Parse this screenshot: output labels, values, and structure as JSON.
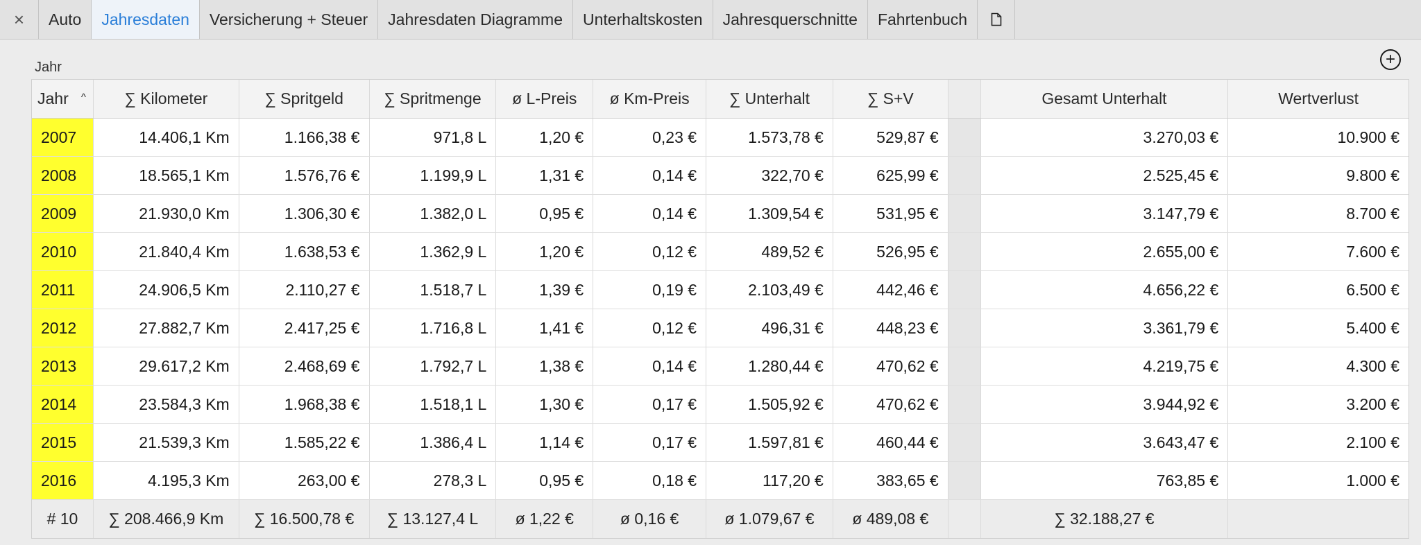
{
  "tabs": {
    "close_icon": "×",
    "items": [
      "Auto",
      "Jahresdaten",
      "Versicherung + Steuer",
      "Jahresdaten Diagramme",
      "Unterhaltskosten",
      "Jahresquerschnitte",
      "Fahrtenbuch"
    ],
    "active": "Jahresdaten",
    "active_color": "#2a7ed8",
    "doc_icon": "document-icon"
  },
  "section": {
    "label": "Jahr",
    "add_icon": "⊕"
  },
  "table": {
    "headers": [
      "Jahr",
      "∑ Kilometer",
      "∑ Spritgeld",
      "∑ Spritmenge",
      "ø L-Preis",
      "ø Km-Preis",
      "∑ Unterhalt",
      "∑ S+V",
      "",
      "Gesamt Unterhalt",
      "Wertverlust"
    ],
    "sort_indicator": "^",
    "year_highlight_color": "#ffff2e",
    "rows": [
      [
        "2007",
        "14.406,1 Km",
        "1.166,38 €",
        "971,8 L",
        "1,20 €",
        "0,23 €",
        "1.573,78 €",
        "529,87 €",
        "",
        "3.270,03 €",
        "10.900 €"
      ],
      [
        "2008",
        "18.565,1 Km",
        "1.576,76 €",
        "1.199,9 L",
        "1,31 €",
        "0,14 €",
        "322,70 €",
        "625,99 €",
        "",
        "2.525,45 €",
        "9.800 €"
      ],
      [
        "2009",
        "21.930,0 Km",
        "1.306,30 €",
        "1.382,0 L",
        "0,95 €",
        "0,14 €",
        "1.309,54 €",
        "531,95 €",
        "",
        "3.147,79 €",
        "8.700 €"
      ],
      [
        "2010",
        "21.840,4 Km",
        "1.638,53 €",
        "1.362,9 L",
        "1,20 €",
        "0,12 €",
        "489,52 €",
        "526,95 €",
        "",
        "2.655,00 €",
        "7.600 €"
      ],
      [
        "2011",
        "24.906,5 Km",
        "2.110,27 €",
        "1.518,7 L",
        "1,39 €",
        "0,19 €",
        "2.103,49 €",
        "442,46 €",
        "",
        "4.656,22 €",
        "6.500 €"
      ],
      [
        "2012",
        "27.882,7 Km",
        "2.417,25 €",
        "1.716,8 L",
        "1,41 €",
        "0,12 €",
        "496,31 €",
        "448,23 €",
        "",
        "3.361,79 €",
        "5.400 €"
      ],
      [
        "2013",
        "29.617,2 Km",
        "2.468,69 €",
        "1.792,7 L",
        "1,38 €",
        "0,14 €",
        "1.280,44 €",
        "470,62 €",
        "",
        "4.219,75 €",
        "4.300 €"
      ],
      [
        "2014",
        "23.584,3 Km",
        "1.968,38 €",
        "1.518,1 L",
        "1,30 €",
        "0,17 €",
        "1.505,92 €",
        "470,62 €",
        "",
        "3.944,92 €",
        "3.200 €"
      ],
      [
        "2015",
        "21.539,3 Km",
        "1.585,22 €",
        "1.386,4 L",
        "1,14 €",
        "0,17 €",
        "1.597,81 €",
        "460,44 €",
        "",
        "3.643,47 €",
        "2.100 €"
      ],
      [
        "2016",
        "4.195,3 Km",
        "263,00 €",
        "278,3 L",
        "0,95 €",
        "0,18 €",
        "117,20 €",
        "383,65 €",
        "",
        "763,85 €",
        "1.000 €"
      ]
    ],
    "footer": [
      "# 10",
      "∑ 208.466,9 Km",
      "∑ 16.500,78 €",
      "∑ 13.127,4 L",
      "ø 1,22 €",
      "ø 0,16 €",
      "ø 1.079,67 €",
      "ø 489,08 €",
      "",
      "∑ 32.188,27 €",
      ""
    ]
  }
}
